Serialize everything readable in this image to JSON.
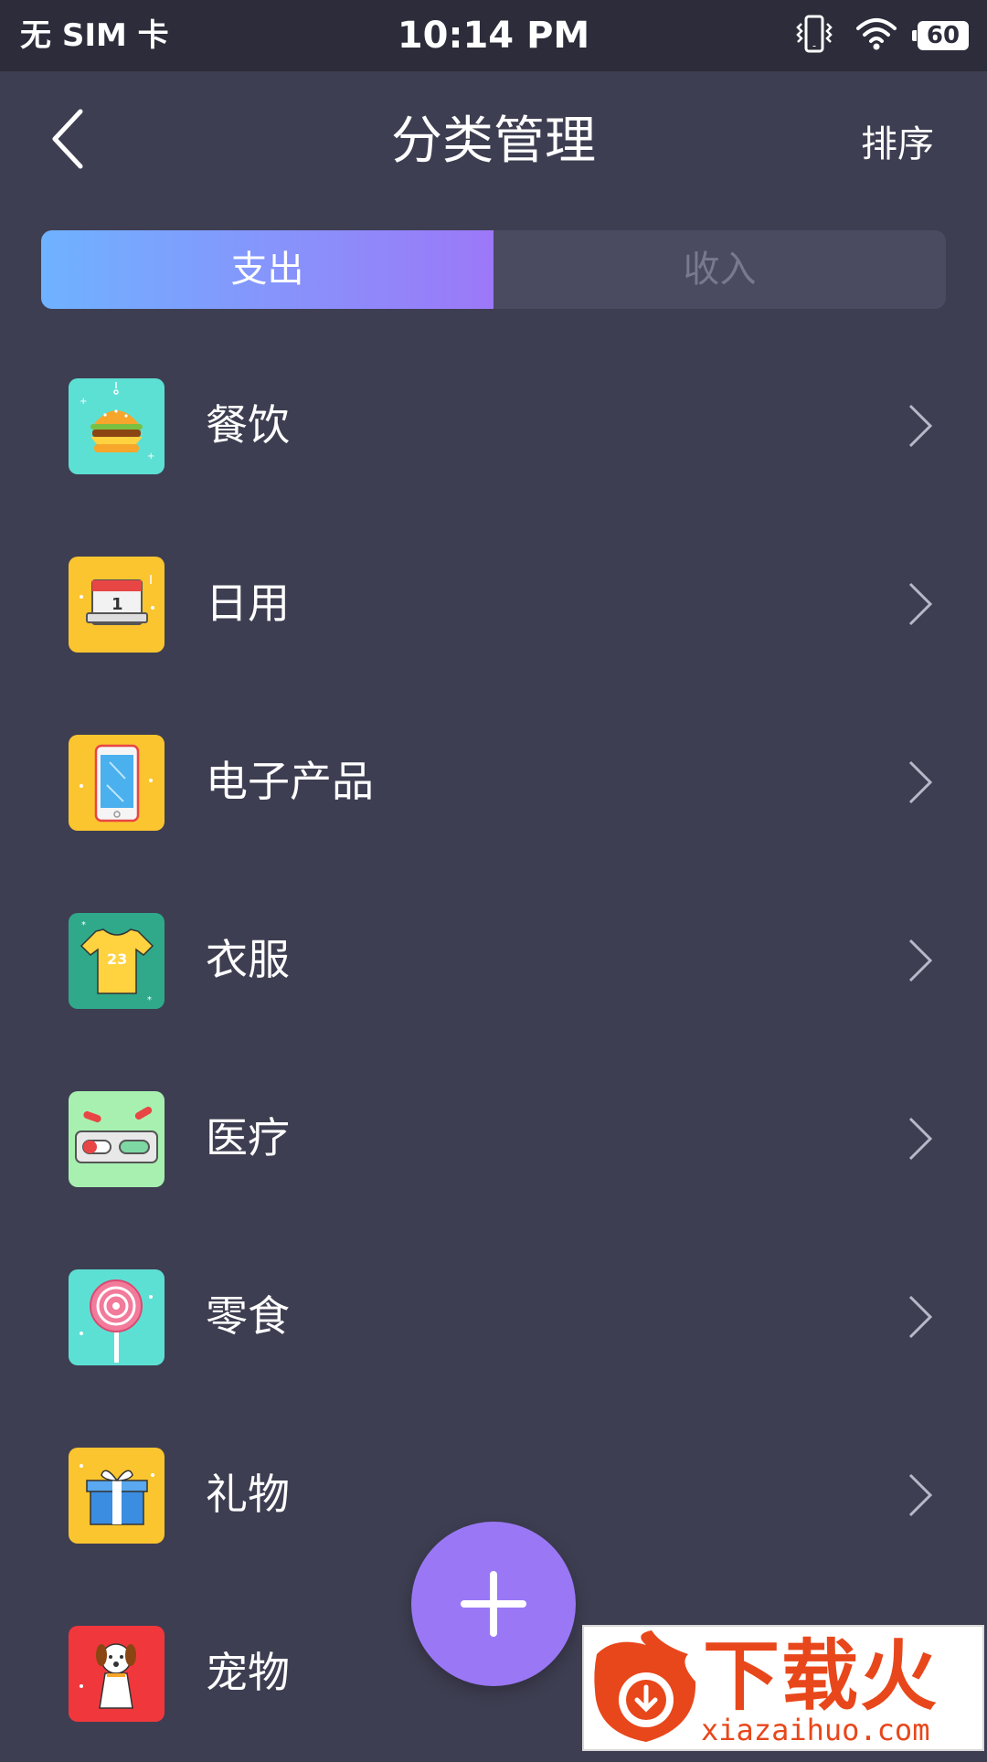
{
  "status_bar": {
    "carrier": "无 SIM 卡",
    "time": "10:14 PM",
    "battery": "60",
    "icons": [
      "vibrate-icon",
      "wifi-icon",
      "battery-icon"
    ]
  },
  "header": {
    "title": "分类管理",
    "sort_label": "排序",
    "back_icon": "chevron-left-icon"
  },
  "tabs": [
    {
      "label": "支出",
      "active": true
    },
    {
      "label": "收入",
      "active": false
    }
  ],
  "categories": [
    {
      "label": "餐饮",
      "icon": "burger-icon",
      "icon_bg": "#5de0d4"
    },
    {
      "label": "日用",
      "icon": "calendar-icon",
      "icon_bg": "#fbc52f"
    },
    {
      "label": "电子产品",
      "icon": "phone-icon",
      "icon_bg": "#fbc52f"
    },
    {
      "label": "衣服",
      "icon": "shirt-icon",
      "icon_bg": "#2fa98a"
    },
    {
      "label": "医疗",
      "icon": "pills-icon",
      "icon_bg": "#a8f0b0"
    },
    {
      "label": "零食",
      "icon": "lollipop-icon",
      "icon_bg": "#5de0d4"
    },
    {
      "label": "礼物",
      "icon": "gift-icon",
      "icon_bg": "#fbc52f"
    },
    {
      "label": "宠物",
      "icon": "dog-icon",
      "icon_bg": "#f0383c"
    }
  ],
  "shirt_number": "23",
  "calendar_number": "1",
  "fab": {
    "icon": "plus-icon",
    "color": "#9a78f5"
  },
  "watermark": {
    "title": "下载火",
    "subtitle": "xiazaihuo.com"
  },
  "colors": {
    "background": "#3e3e52",
    "status_bar": "#2c2c3a",
    "tab_gradient_start": "#6fb2ff",
    "tab_gradient_end": "#9c78f8"
  }
}
